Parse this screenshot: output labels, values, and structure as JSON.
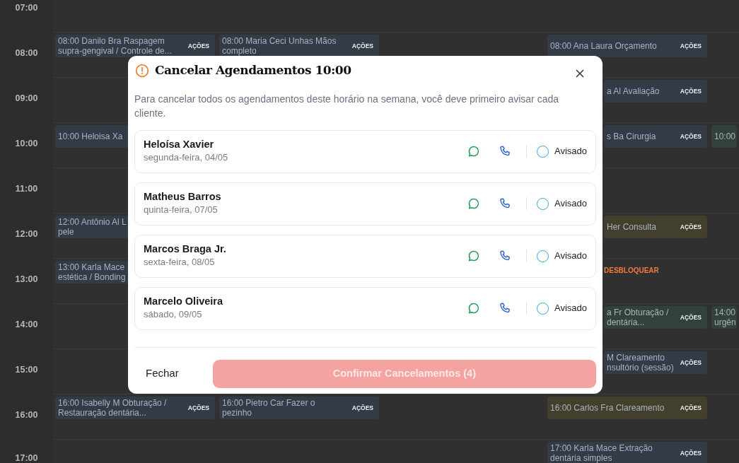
{
  "calendar": {
    "rows": [
      {
        "time": "07:00",
        "cells": [
          null,
          null,
          null,
          null,
          null
        ]
      },
      {
        "time": "08:00",
        "cells": [
          {
            "text": "08:00 Danilo Bra Raspagem supra-gengival / Controle de...",
            "actions": "AÇÕES",
            "color": "#333b47"
          },
          {
            "text": "08:00 Maria Ceci Unhas Mãos completo",
            "actions": "AÇÕES",
            "color": "#333b47"
          },
          null,
          {
            "text": "08:00 Ana Laura Orçamento",
            "actions": "AÇÕES",
            "color": "#333b47"
          },
          null
        ]
      },
      {
        "time": "09:00",
        "cells": [
          null,
          null,
          null,
          {
            "text": "a Al Avaliação",
            "actions": "AÇÕES",
            "color": "#333b47",
            "cut_left": true
          },
          null
        ]
      },
      {
        "time": "10:00",
        "cells": [
          {
            "text": "10:00 Heloisa Xa",
            "color": "#333b47"
          },
          null,
          null,
          {
            "text": "s Ba Cirurgia",
            "actions": "AÇÕES",
            "color": "#333b47",
            "cut_left": true
          },
          {
            "text": "10:00",
            "color": "#32413a"
          }
        ]
      },
      {
        "time": "11:00",
        "cells": [
          null,
          null,
          null,
          null,
          null
        ]
      },
      {
        "time": "12:00",
        "cells": [
          {
            "text": "12:00 Antônio Al L\npele",
            "color": "#333b47"
          },
          null,
          null,
          {
            "text": "Her Consulta",
            "actions": "AÇÕES",
            "color": "#433f2d",
            "cut_left": true
          },
          null
        ]
      },
      {
        "time": "13:00",
        "cells": [
          {
            "text": "13:00 Karla Mace\nestética / Bonding",
            "color": "#333b47"
          },
          null,
          null,
          {
            "kind": "blocked",
            "text": "DESBLOQUEAR",
            "cut_left": true
          },
          null
        ]
      },
      {
        "time": "14:00",
        "cells": [
          null,
          null,
          null,
          {
            "text": "a Fr Obturação /\ndentária...",
            "actions": "AÇÕES",
            "color": "#32413a",
            "cut_left": true
          },
          {
            "text": "14:00\nurgên",
            "color": "#32413a"
          }
        ]
      },
      {
        "time": "15:00",
        "cells": [
          null,
          null,
          null,
          {
            "text": "M Clareamento\nnsultório (sessão)",
            "actions": "AÇÕES",
            "color": "#333b47",
            "cut_left": true
          },
          null
        ]
      },
      {
        "time": "16:00",
        "cells": [
          {
            "text": "16:00 Isabelly M Obturação /\nRestauração dentária...",
            "actions": "AÇÕES",
            "color": "#333b47"
          },
          {
            "text": "16:00 Pietro Car Fazer o\npezinho",
            "actions": "AÇÕES",
            "color": "#333b47"
          },
          null,
          {
            "text": "16:00 Carlos Fra Clareamento",
            "actions": "AÇÕES",
            "color": "#433f2d"
          },
          null
        ]
      },
      {
        "time": "17:00",
        "cells": [
          null,
          null,
          null,
          {
            "text": "17:00 Karla Mace Extração\ndentária simples",
            "actions": "AÇÕES",
            "color": "#333b47"
          },
          null
        ]
      }
    ]
  },
  "modal": {
    "title": "Cancelar Agendamentos 10:00",
    "description": "Para cancelar todos os agendamentos deste horário na semana, você deve primeiro avisar cada cliente.",
    "clients": [
      {
        "name": "Heloísa Xavier",
        "date": "segunda-feira, 04/05",
        "notified_label": "Avisado",
        "notified": false
      },
      {
        "name": "Matheus Barros",
        "date": "quinta-feira, 07/05",
        "notified_label": "Avisado",
        "notified": false
      },
      {
        "name": "Marcos Braga Jr.",
        "date": "sexta-feira, 08/05",
        "notified_label": "Avisado",
        "notified": false
      },
      {
        "name": "Marcelo Oliveira",
        "date": "sábado, 09/05",
        "notified_label": "Avisado",
        "notified": false
      }
    ],
    "close_button": "Fechar",
    "confirm_button": {
      "label": "Confirmar Cancelamentos (4)",
      "disabled": true
    }
  }
}
